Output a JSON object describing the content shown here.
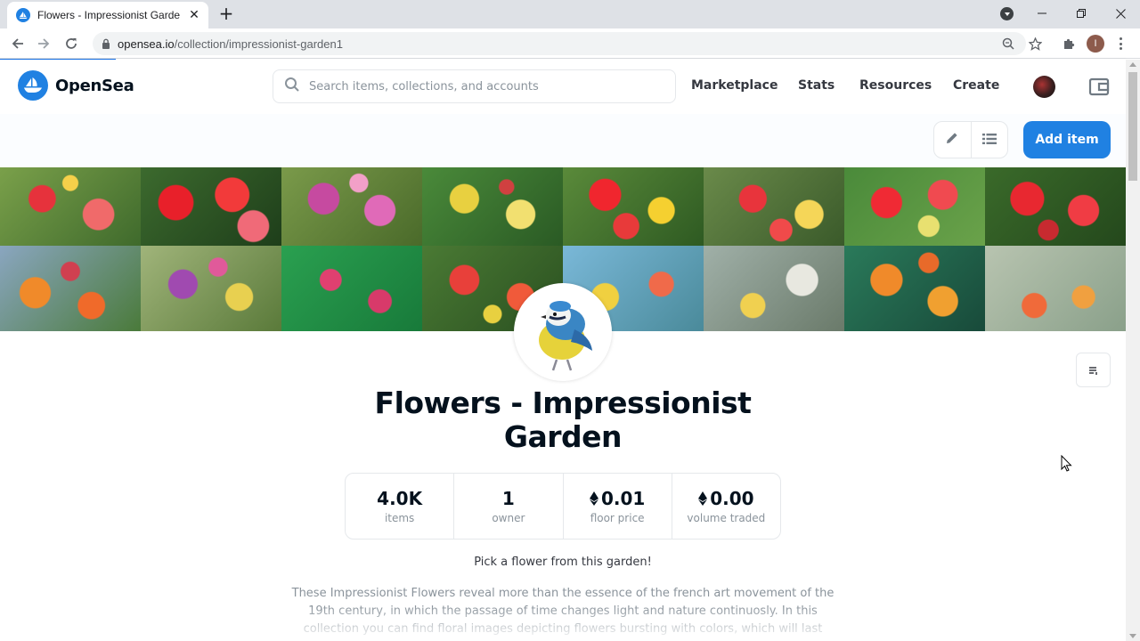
{
  "browser": {
    "tab_title": "Flowers - Impressionist Garden -",
    "url_host": "opensea.io",
    "url_path": "/collection/impressionist-garden1",
    "profile_initial": "I"
  },
  "header": {
    "brand": "OpenSea",
    "search_placeholder": "Search items, collections, and accounts",
    "nav": [
      "Marketplace",
      "Stats",
      "Resources",
      "Create"
    ]
  },
  "actions": {
    "add_item_label": "Add item"
  },
  "collection": {
    "title": "Flowers - Impressionist Garden",
    "stats": [
      {
        "value": "4.0K",
        "label": "items",
        "eth": false
      },
      {
        "value": "1",
        "label": "owner",
        "eth": false
      },
      {
        "value": "0.01",
        "label": "floor price",
        "eth": true
      },
      {
        "value": "0.00",
        "label": "volume traded",
        "eth": true
      }
    ],
    "tagline": "Pick a flower from this garden!",
    "description": "These Impressionist Flowers reveal more than the essence of the french art movement of the 19th century, in which the passage of time changes light and nature continuosly. In this collection you can find floral images depicting flowers bursting with colors, which will last"
  },
  "colors": {
    "brand_blue": "#2081e2",
    "text_dark": "#04111d",
    "text_muted": "#8a939b",
    "border": "#e5e8eb"
  },
  "icons": [
    "search-icon",
    "pencil-icon",
    "list-icon",
    "wallet-icon",
    "sort-icon",
    "ethereum-icon"
  ]
}
